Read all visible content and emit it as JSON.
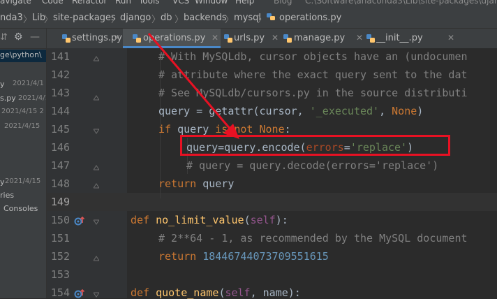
{
  "menu": [
    "avigate",
    "Code",
    "Refactor",
    "Run",
    "Tools",
    "VCS",
    "Window",
    "Help",
    "Blog",
    "C:\\Software\\anaconda3\\Lib\\site-packages\\djan"
  ],
  "breadcrumb": [
    "nda3",
    "Lib",
    "site-packages",
    "django",
    "db",
    "backends",
    "mysql",
    "operations.py"
  ],
  "project_panel": {
    "path_fragment": "ge\\python\\",
    "items": [
      {
        "label": "y",
        "date": "2021/4/1"
      },
      {
        "label": "s.py",
        "date": "2021/4/1"
      },
      {
        "label": "",
        "date": "2021/4/15 2"
      },
      {
        "label": "",
        "date": "2021/4/15"
      },
      {
        "label": "y",
        "date": "2021/4/15"
      },
      {
        "label": "ries",
        "date": ""
      },
      {
        "label": "Consoles",
        "date": ""
      }
    ]
  },
  "tabs": [
    {
      "label": "settings.py",
      "active": false
    },
    {
      "label": "operations.py",
      "active": true
    },
    {
      "label": "urls.py",
      "active": false
    },
    {
      "label": "manage.py",
      "active": false
    },
    {
      "label": "__init__.py",
      "active": false
    }
  ],
  "editor": {
    "current_line": 149,
    "lines": [
      {
        "no": "141",
        "text": "# With MySQLdb, cursor objects have an (undocumen"
      },
      {
        "no": "142",
        "text": "# attribute where the exact query sent to the dat"
      },
      {
        "no": "143",
        "text": "# See MySQLdb/cursors.py in the source distributi"
      },
      {
        "no": "144",
        "text": "query = getattr(cursor, '_executed', None)"
      },
      {
        "no": "145",
        "text": "if query is not None:"
      },
      {
        "no": "146",
        "text": "query=query.encode(errors='replace')"
      },
      {
        "no": "147",
        "text": "# query = query.decode(errors='replace')"
      },
      {
        "no": "148",
        "text": "return query"
      },
      {
        "no": "149",
        "text": ""
      },
      {
        "no": "150",
        "text": "def no_limit_value(self):"
      },
      {
        "no": "151",
        "text": "# 2**64 - 1, as recommended by the MySQL document"
      },
      {
        "no": "152",
        "text": "return 18446744073709551615"
      },
      {
        "no": "153",
        "text": ""
      },
      {
        "no": "154",
        "text": "def quote_name(self, name):"
      }
    ]
  },
  "colors": {
    "keyword": "#cc7832",
    "comment": "#808080",
    "string": "#6a8759",
    "number": "#6897bb",
    "function": "#ffc66d",
    "highlight": "#e81123"
  }
}
